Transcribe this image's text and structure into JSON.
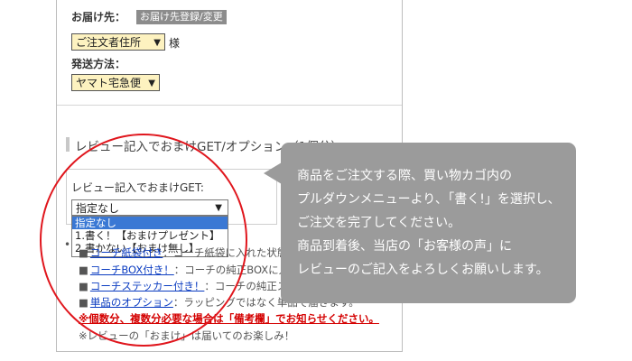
{
  "delivery": {
    "label": "お届け先：",
    "register_button": "お届け先登録/変更",
    "address_select": "ご注文者住所",
    "suffix": "様"
  },
  "shipping": {
    "label": "発送方法：",
    "method_select": "ヤマト宅急便"
  },
  "review_section": {
    "heading": "レビュー記入でおまけGET/オプション（1個分）",
    "field_label": "レビュー記入でおまけGET:",
    "select_value": "指定なし",
    "options": [
      "指定なし",
      "1.書く！【おまけプレゼント】",
      "2.書かない【おまけ無し】"
    ]
  },
  "option_lines": {
    "l1_prefix": "",
    "l1_link": "コーチ紙袋付き",
    "l1_text": "：コーチ紙袋に入れた状態でお届けします。",
    "l2_link": "コーチBOX付き！",
    "l2_text": "：コーチの純正BOXに入れてお届け。",
    "l3_link": "コーチステッカー付き！",
    "l3_text": "：コーチの純正ステッカー付き。",
    "l4_link": "単品のオプション",
    "l4_text": "：ラッピングではなく単品で届きます。",
    "warning": "※個数分、複数分必要な場合は「備考欄」でお知らせください。",
    "note": "※レビューの「おまけ」は届いてのお楽しみ！"
  },
  "tooltip": {
    "lines": [
      "商品をご注文する際、買い物カゴ内の",
      "プルダウンメニューより､「書く!」を選択し､",
      "ご注文を完了してください。",
      "商品到着後、当店の「お客様の声」に",
      "レビューのご記入をよろしくお願いします。"
    ]
  },
  "colors": {
    "annotation_circle": "#e0161d",
    "tooltip_bg": "#9b9b9b",
    "select_bg": "#fdf2c0",
    "selected_option": "#3a78d4",
    "link": "#0b3cc1",
    "warning": "#d40000"
  }
}
